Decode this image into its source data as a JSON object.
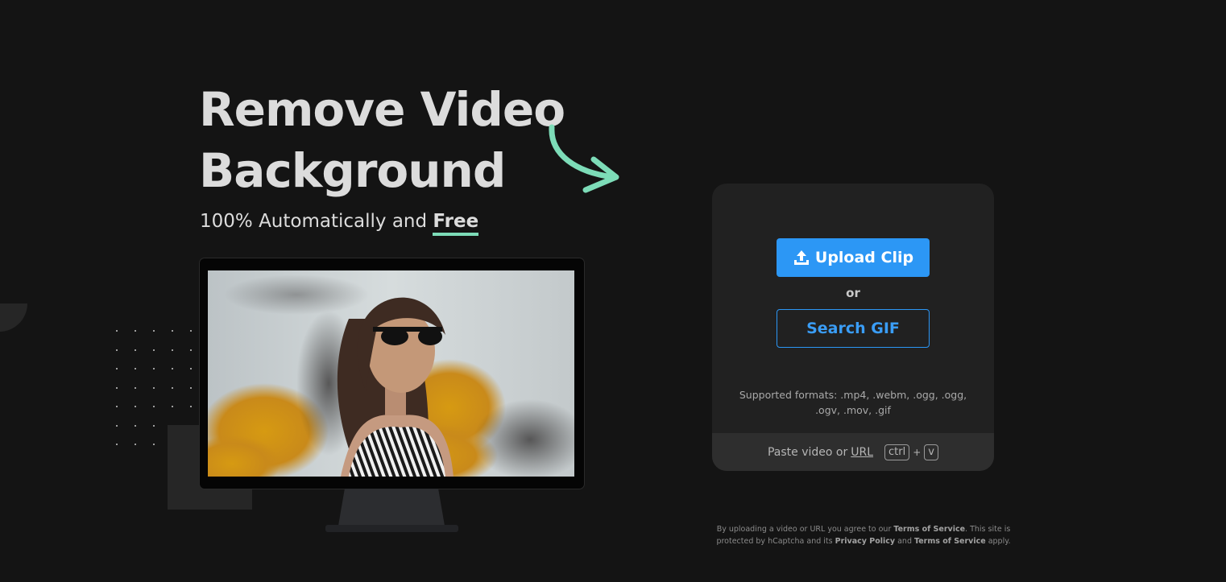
{
  "hero": {
    "title_line1": "Remove Video",
    "title_line2": "Background",
    "subtitle_prefix": "100% Automatically and ",
    "subtitle_emphasis": "Free"
  },
  "upload": {
    "upload_button_label": "Upload Clip",
    "or_label": "or",
    "search_button_label": "Search GIF",
    "formats_text": "Supported formats: .mp4, .webm, .ogg, .ogg, .ogv, .mov, .gif",
    "paste_prefix": "Paste video or ",
    "paste_url_link": "URL",
    "key_ctrl": "ctrl",
    "key_plus": "+",
    "key_v": "v"
  },
  "legal": {
    "part1": "By uploading a video or URL you agree to our ",
    "terms_link_1": "Terms of Service",
    "part2": ". This site is protected by hCaptcha and its ",
    "privacy_link": "Privacy Policy",
    "part3": " and ",
    "terms_link_2": "Terms of Service",
    "part4": " apply."
  },
  "icons": {
    "upload": "upload-icon",
    "arrow": "curved-arrow-icon"
  },
  "colors": {
    "background": "#141414",
    "accent_blue": "#2c97f5",
    "accent_green": "#7ddcb8",
    "card": "#212121",
    "title_text": "#dcdcdc"
  }
}
